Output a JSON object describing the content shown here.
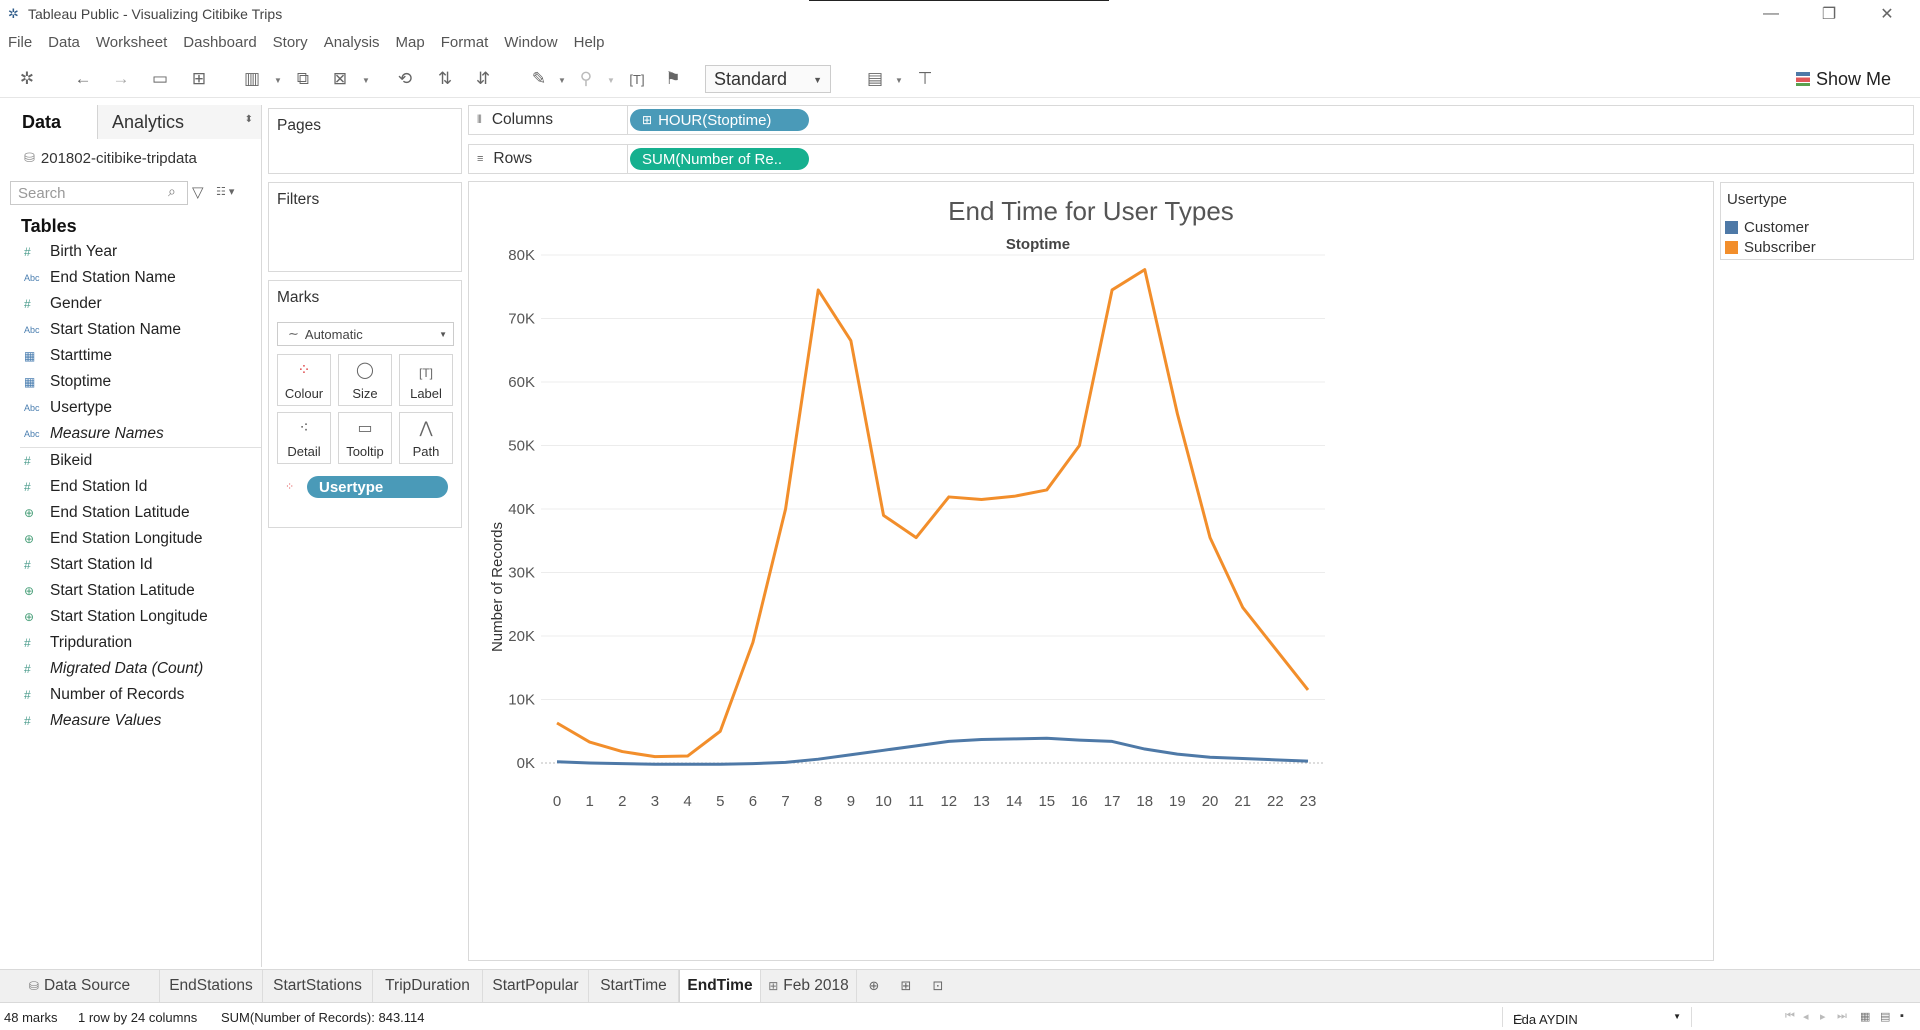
{
  "window": {
    "title": "Tableau Public - Visualizing Citibike Trips",
    "minimize": "—",
    "restore": "❐",
    "close": "✕"
  },
  "menu": [
    "File",
    "Data",
    "Worksheet",
    "Dashboard",
    "Story",
    "Analysis",
    "Map",
    "Format",
    "Window",
    "Help"
  ],
  "toolbar": {
    "fit_value": "Standard",
    "show_me_label": "Show Me"
  },
  "data_pane": {
    "tabs": {
      "data": "Data",
      "analytics": "Analytics"
    },
    "datasource": "201802-citibike-tripdata",
    "search_placeholder": "Search",
    "tables_title": "Tables",
    "dimensions": [
      {
        "type": "num",
        "name": "Birth Year"
      },
      {
        "type": "abc",
        "name": "End Station Name"
      },
      {
        "type": "num",
        "name": "Gender"
      },
      {
        "type": "abc",
        "name": "Start Station Name"
      },
      {
        "type": "cal",
        "name": "Starttime"
      },
      {
        "type": "cal",
        "name": "Stoptime"
      },
      {
        "type": "abc",
        "name": "Usertype"
      },
      {
        "type": "abc",
        "name": "Measure Names",
        "italic": true
      }
    ],
    "measures": [
      {
        "type": "num",
        "name": "Bikeid"
      },
      {
        "type": "num",
        "name": "End Station Id"
      },
      {
        "type": "geo",
        "name": "End Station Latitude"
      },
      {
        "type": "geo",
        "name": "End Station Longitude"
      },
      {
        "type": "num",
        "name": "Start Station Id"
      },
      {
        "type": "geo",
        "name": "Start Station Latitude"
      },
      {
        "type": "geo",
        "name": "Start Station Longitude"
      },
      {
        "type": "num",
        "name": "Tripduration"
      },
      {
        "type": "num",
        "name": "Migrated Data (Count)",
        "italic": true
      },
      {
        "type": "num",
        "name": "Number of Records"
      },
      {
        "type": "num",
        "name": "Measure Values",
        "italic": true
      }
    ]
  },
  "cards": {
    "pages": "Pages",
    "filters": "Filters",
    "marks": "Marks",
    "mark_type": "Automatic",
    "mark_buttons": [
      "Colour",
      "Size",
      "Label",
      "Detail",
      "Tooltip",
      "Path"
    ],
    "color_pill": "Usertype"
  },
  "shelves": {
    "columns_label": "Columns",
    "columns_pill": "HOUR(Stoptime)",
    "rows_label": "Rows",
    "rows_pill": "SUM(Number of Re.."
  },
  "legend": {
    "title": "Usertype",
    "items": [
      {
        "name": "Customer",
        "color": "#4e79a7"
      },
      {
        "name": "Subscriber",
        "color": "#f28e2b"
      }
    ]
  },
  "chart_data": {
    "type": "line",
    "title": "End Time for User Types",
    "subtitle": "Stoptime",
    "xlabel": "",
    "ylabel": "Number of Records",
    "x": [
      0,
      1,
      2,
      3,
      4,
      5,
      6,
      7,
      8,
      9,
      10,
      11,
      12,
      13,
      14,
      15,
      16,
      17,
      18,
      19,
      20,
      21,
      22,
      23
    ],
    "ylim": [
      0,
      80000
    ],
    "yticks": [
      "0K",
      "10K",
      "20K",
      "30K",
      "40K",
      "50K",
      "60K",
      "70K",
      "80K"
    ],
    "grid": true,
    "series": [
      {
        "name": "Customer",
        "color": "#4e79a7",
        "values": [
          200,
          0,
          -100,
          -200,
          -200,
          -200,
          -100,
          100,
          600,
          1300,
          2000,
          2700,
          3400,
          3700,
          3800,
          3900,
          3600,
          3400,
          2200,
          1400,
          900,
          700,
          500,
          300
        ]
      },
      {
        "name": "Subscriber",
        "color": "#f28e2b",
        "values": [
          6300,
          3300,
          1800,
          1000,
          1100,
          5000,
          19000,
          40000,
          74500,
          66500,
          39000,
          35500,
          41900,
          41500,
          42000,
          43000,
          50000,
          74500,
          77700,
          55000,
          35500,
          24500,
          18000,
          11500
        ]
      }
    ]
  },
  "sheet_tabs": [
    "Data Source",
    "EndStations",
    "StartStations",
    "TripDuration",
    "StartPopular",
    "StartTime",
    "EndTime",
    "Feb 2018"
  ],
  "active_tab": "EndTime",
  "status": {
    "marks": "48 marks",
    "rows_cols": "1 row by 24 columns",
    "sum": "SUM(Number of Records): 843.114",
    "user": "Eda AYDIN"
  }
}
